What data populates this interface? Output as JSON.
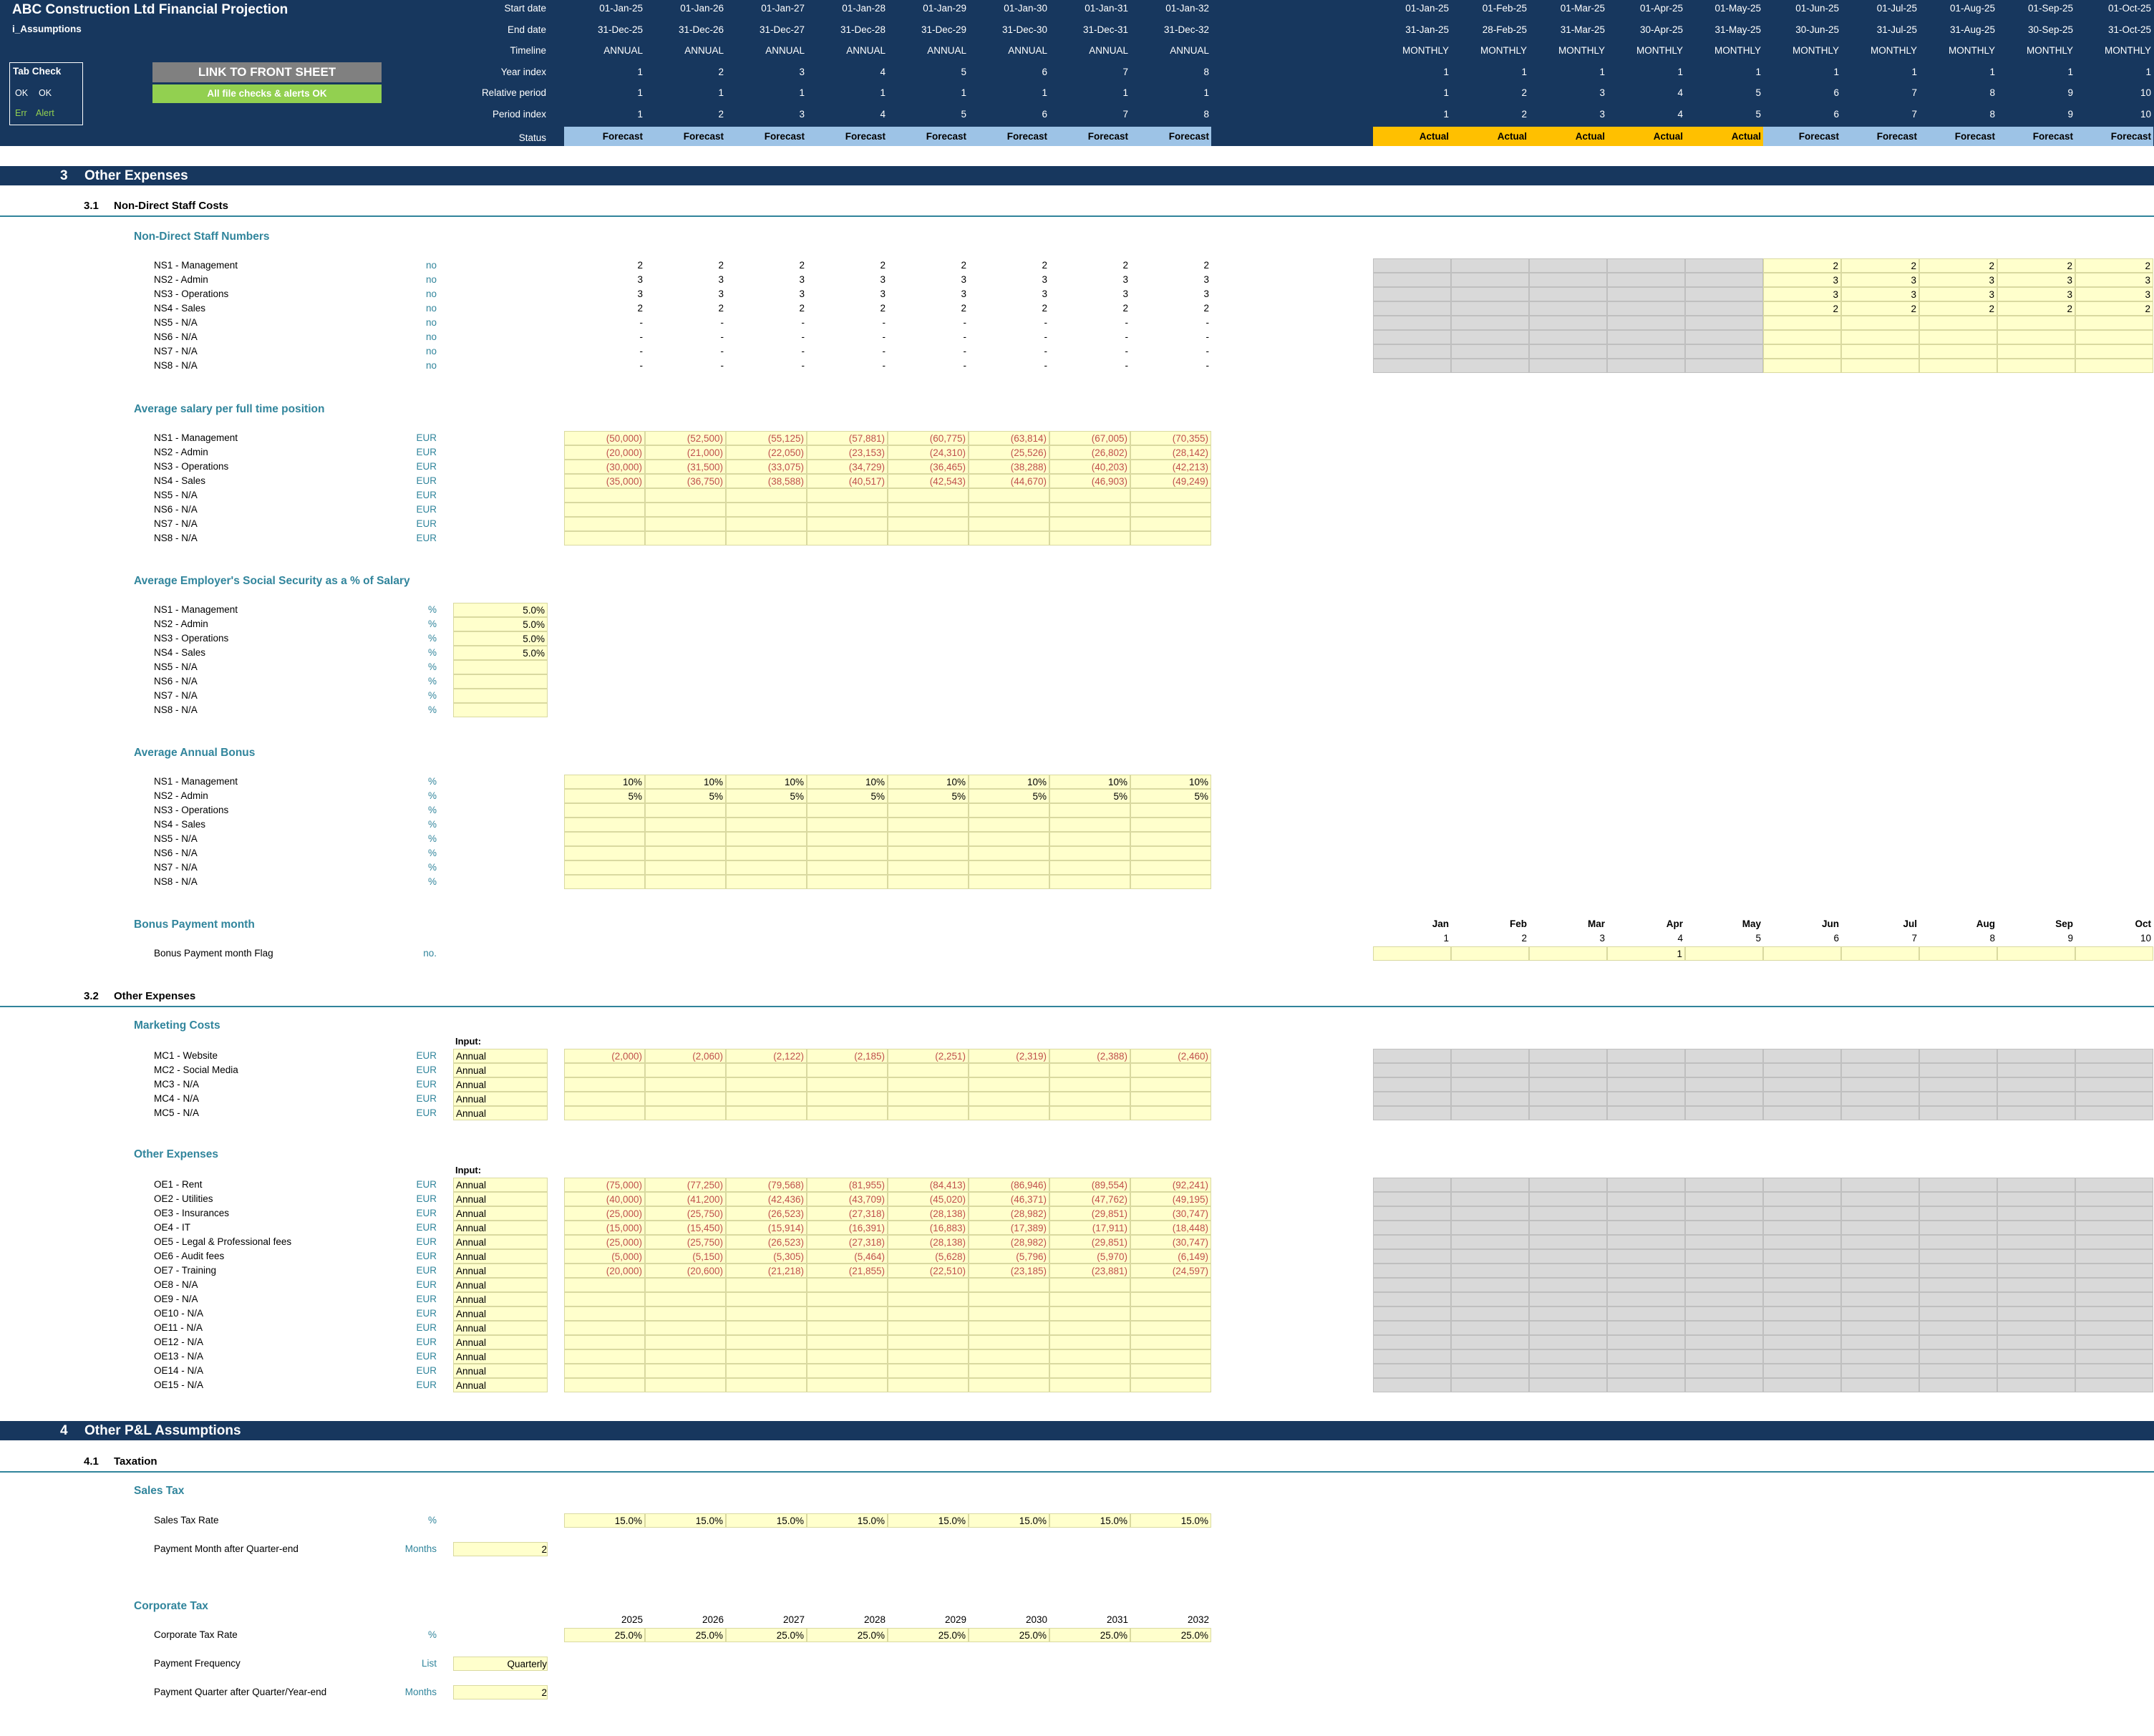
{
  "app": {
    "title": "ABC Construction Ltd Financial Projection",
    "sheet": "i_Assumptions"
  },
  "tab_check": {
    "title": "Tab Check",
    "ok_code": "OK",
    "ok_label": "OK",
    "err_code": "Err",
    "err_label": "Alert"
  },
  "link_button": "LINK TO FRONT SHEET",
  "checks_status": "All file checks & alerts OK",
  "header_rows": [
    "Start date",
    "End date",
    "Timeline",
    "Year index",
    "Relative period",
    "Period index",
    "Status"
  ],
  "annual_cols": [
    {
      "start": "01-Jan-25",
      "end": "31-Dec-25",
      "timeline": "ANNUAL",
      "year_index": "1",
      "rel": "1",
      "period": "1",
      "status": "Forecast"
    },
    {
      "start": "01-Jan-26",
      "end": "31-Dec-26",
      "timeline": "ANNUAL",
      "year_index": "2",
      "rel": "1",
      "period": "2",
      "status": "Forecast"
    },
    {
      "start": "01-Jan-27",
      "end": "31-Dec-27",
      "timeline": "ANNUAL",
      "year_index": "3",
      "rel": "1",
      "period": "3",
      "status": "Forecast"
    },
    {
      "start": "01-Jan-28",
      "end": "31-Dec-28",
      "timeline": "ANNUAL",
      "year_index": "4",
      "rel": "1",
      "period": "4",
      "status": "Forecast"
    },
    {
      "start": "01-Jan-29",
      "end": "31-Dec-29",
      "timeline": "ANNUAL",
      "year_index": "5",
      "rel": "1",
      "period": "5",
      "status": "Forecast"
    },
    {
      "start": "01-Jan-30",
      "end": "31-Dec-30",
      "timeline": "ANNUAL",
      "year_index": "6",
      "rel": "1",
      "period": "6",
      "status": "Forecast"
    },
    {
      "start": "01-Jan-31",
      "end": "31-Dec-31",
      "timeline": "ANNUAL",
      "year_index": "7",
      "rel": "1",
      "period": "7",
      "status": "Forecast"
    },
    {
      "start": "01-Jan-32",
      "end": "31-Dec-32",
      "timeline": "ANNUAL",
      "year_index": "8",
      "rel": "1",
      "period": "8",
      "status": "Forecast"
    }
  ],
  "monthly_cols": [
    {
      "start": "01-Jan-25",
      "end": "31-Jan-25",
      "timeline": "MONTHLY",
      "year_index": "1",
      "rel": "1",
      "period": "1",
      "status": "Actual",
      "month": "Jan",
      "mnum": "1",
      "flag": ""
    },
    {
      "start": "01-Feb-25",
      "end": "28-Feb-25",
      "timeline": "MONTHLY",
      "year_index": "1",
      "rel": "2",
      "period": "2",
      "status": "Actual",
      "month": "Feb",
      "mnum": "2",
      "flag": ""
    },
    {
      "start": "01-Mar-25",
      "end": "31-Mar-25",
      "timeline": "MONTHLY",
      "year_index": "1",
      "rel": "3",
      "period": "3",
      "status": "Actual",
      "month": "Mar",
      "mnum": "3",
      "flag": ""
    },
    {
      "start": "01-Apr-25",
      "end": "30-Apr-25",
      "timeline": "MONTHLY",
      "year_index": "1",
      "rel": "4",
      "period": "4",
      "status": "Actual",
      "month": "Apr",
      "mnum": "4",
      "flag": "1"
    },
    {
      "start": "01-May-25",
      "end": "31-May-25",
      "timeline": "MONTHLY",
      "year_index": "1",
      "rel": "5",
      "period": "5",
      "status": "Actual",
      "month": "May",
      "mnum": "5",
      "flag": ""
    },
    {
      "start": "01-Jun-25",
      "end": "30-Jun-25",
      "timeline": "MONTHLY",
      "year_index": "1",
      "rel": "6",
      "period": "6",
      "status": "Forecast",
      "month": "Jun",
      "mnum": "6",
      "flag": ""
    },
    {
      "start": "01-Jul-25",
      "end": "31-Jul-25",
      "timeline": "MONTHLY",
      "year_index": "1",
      "rel": "7",
      "period": "7",
      "status": "Forecast",
      "month": "Jul",
      "mnum": "7",
      "flag": ""
    },
    {
      "start": "01-Aug-25",
      "end": "31-Aug-25",
      "timeline": "MONTHLY",
      "year_index": "1",
      "rel": "8",
      "period": "8",
      "status": "Forecast",
      "month": "Aug",
      "mnum": "8",
      "flag": ""
    },
    {
      "start": "01-Sep-25",
      "end": "30-Sep-25",
      "timeline": "MONTHLY",
      "year_index": "1",
      "rel": "9",
      "period": "9",
      "status": "Forecast",
      "month": "Sep",
      "mnum": "9",
      "flag": ""
    },
    {
      "start": "01-Oct-25",
      "end": "31-Oct-25",
      "timeline": "MONTHLY",
      "year_index": "1",
      "rel": "10",
      "period": "10",
      "status": "Forecast",
      "month": "Oct",
      "mnum": "10",
      "flag": ""
    }
  ],
  "section3": {
    "num": "3",
    "title": "Other Expenses"
  },
  "sub31": {
    "num": "3.1",
    "title": "Non-Direct Staff Costs"
  },
  "staff_numbers": {
    "title": "Non-Direct Staff Numbers",
    "rows": [
      {
        "label": "NS1 - Management",
        "unit": "no",
        "values": [
          "2",
          "2",
          "2",
          "2",
          "2",
          "2",
          "2",
          "2"
        ],
        "monthly": [
          "2",
          "2",
          "2",
          "2",
          "2"
        ]
      },
      {
        "label": "NS2 - Admin",
        "unit": "no",
        "values": [
          "3",
          "3",
          "3",
          "3",
          "3",
          "3",
          "3",
          "3"
        ],
        "monthly": [
          "3",
          "3",
          "3",
          "3",
          "3"
        ]
      },
      {
        "label": "NS3 - Operations",
        "unit": "no",
        "values": [
          "3",
          "3",
          "3",
          "3",
          "3",
          "3",
          "3",
          "3"
        ],
        "monthly": [
          "3",
          "3",
          "3",
          "3",
          "3"
        ]
      },
      {
        "label": "NS4 - Sales",
        "unit": "no",
        "values": [
          "2",
          "2",
          "2",
          "2",
          "2",
          "2",
          "2",
          "2"
        ],
        "monthly": [
          "2",
          "2",
          "2",
          "2",
          "2"
        ]
      },
      {
        "label": "NS5 - N/A",
        "unit": "no",
        "values": [
          "-",
          "-",
          "-",
          "-",
          "-",
          "-",
          "-",
          "-"
        ],
        "monthly": [
          "",
          "",
          "",
          "",
          ""
        ]
      },
      {
        "label": "NS6 - N/A",
        "unit": "no",
        "values": [
          "-",
          "-",
          "-",
          "-",
          "-",
          "-",
          "-",
          "-"
        ],
        "monthly": [
          "",
          "",
          "",
          "",
          ""
        ]
      },
      {
        "label": "NS7 - N/A",
        "unit": "no",
        "values": [
          "-",
          "-",
          "-",
          "-",
          "-",
          "-",
          "-",
          "-"
        ],
        "monthly": [
          "",
          "",
          "",
          "",
          ""
        ]
      },
      {
        "label": "NS8 - N/A",
        "unit": "no",
        "values": [
          "-",
          "-",
          "-",
          "-",
          "-",
          "-",
          "-",
          "-"
        ],
        "monthly": [
          "",
          "",
          "",
          "",
          ""
        ]
      }
    ]
  },
  "avg_salary": {
    "title": "Average salary per full time position",
    "rows": [
      {
        "label": "NS1 - Management",
        "unit": "EUR",
        "values": [
          "(50,000)",
          "(52,500)",
          "(55,125)",
          "(57,881)",
          "(60,775)",
          "(63,814)",
          "(67,005)",
          "(70,355)"
        ]
      },
      {
        "label": "NS2 - Admin",
        "unit": "EUR",
        "values": [
          "(20,000)",
          "(21,000)",
          "(22,050)",
          "(23,153)",
          "(24,310)",
          "(25,526)",
          "(26,802)",
          "(28,142)"
        ]
      },
      {
        "label": "NS3 - Operations",
        "unit": "EUR",
        "values": [
          "(30,000)",
          "(31,500)",
          "(33,075)",
          "(34,729)",
          "(36,465)",
          "(38,288)",
          "(40,203)",
          "(42,213)"
        ]
      },
      {
        "label": "NS4 - Sales",
        "unit": "EUR",
        "values": [
          "(35,000)",
          "(36,750)",
          "(38,588)",
          "(40,517)",
          "(42,543)",
          "(44,670)",
          "(46,903)",
          "(49,249)"
        ]
      },
      {
        "label": "NS5 - N/A",
        "unit": "EUR",
        "values": [
          "",
          "",
          "",
          "",
          "",
          "",
          "",
          ""
        ]
      },
      {
        "label": "NS6 - N/A",
        "unit": "EUR",
        "values": [
          "",
          "",
          "",
          "",
          "",
          "",
          "",
          ""
        ]
      },
      {
        "label": "NS7 - N/A",
        "unit": "EUR",
        "values": [
          "",
          "",
          "",
          "",
          "",
          "",
          "",
          ""
        ]
      },
      {
        "label": "NS8 - N/A",
        "unit": "EUR",
        "values": [
          "",
          "",
          "",
          "",
          "",
          "",
          "",
          ""
        ]
      }
    ]
  },
  "social_security": {
    "title": "Average Employer's Social Security as a % of Salary",
    "rows": [
      {
        "label": "NS1 - Management",
        "unit": "%",
        "value": "5.0%"
      },
      {
        "label": "NS2 - Admin",
        "unit": "%",
        "value": "5.0%"
      },
      {
        "label": "NS3 - Operations",
        "unit": "%",
        "value": "5.0%"
      },
      {
        "label": "NS4 - Sales",
        "unit": "%",
        "value": "5.0%"
      },
      {
        "label": "NS5 - N/A",
        "unit": "%",
        "value": ""
      },
      {
        "label": "NS6 - N/A",
        "unit": "%",
        "value": ""
      },
      {
        "label": "NS7 - N/A",
        "unit": "%",
        "value": ""
      },
      {
        "label": "NS8 - N/A",
        "unit": "%",
        "value": ""
      }
    ]
  },
  "annual_bonus": {
    "title": "Average Annual Bonus",
    "rows": [
      {
        "label": "NS1 - Management",
        "unit": "%",
        "values": [
          "10%",
          "10%",
          "10%",
          "10%",
          "10%",
          "10%",
          "10%",
          "10%"
        ]
      },
      {
        "label": "NS2 - Admin",
        "unit": "%",
        "values": [
          "5%",
          "5%",
          "5%",
          "5%",
          "5%",
          "5%",
          "5%",
          "5%"
        ]
      },
      {
        "label": "NS3 - Operations",
        "unit": "%",
        "values": [
          "",
          "",
          "",
          "",
          "",
          "",
          "",
          ""
        ]
      },
      {
        "label": "NS4 - Sales",
        "unit": "%",
        "values": [
          "",
          "",
          "",
          "",
          "",
          "",
          "",
          ""
        ]
      },
      {
        "label": "NS5 - N/A",
        "unit": "%",
        "values": [
          "",
          "",
          "",
          "",
          "",
          "",
          "",
          ""
        ]
      },
      {
        "label": "NS6 - N/A",
        "unit": "%",
        "values": [
          "",
          "",
          "",
          "",
          "",
          "",
          "",
          ""
        ]
      },
      {
        "label": "NS7 - N/A",
        "unit": "%",
        "values": [
          "",
          "",
          "",
          "",
          "",
          "",
          "",
          ""
        ]
      },
      {
        "label": "NS8 - N/A",
        "unit": "%",
        "values": [
          "",
          "",
          "",
          "",
          "",
          "",
          "",
          ""
        ]
      }
    ]
  },
  "bonus_month": {
    "title": "Bonus Payment month",
    "flag_label": "Bonus Payment month Flag",
    "flag_unit": "no."
  },
  "sub32": {
    "num": "3.2",
    "title": "Other Expenses"
  },
  "marketing": {
    "title": "Marketing Costs",
    "input_label": "Input:",
    "rows": [
      {
        "label": "MC1 - Website",
        "unit": "EUR",
        "freq": "Annual",
        "values": [
          "(2,000)",
          "(2,060)",
          "(2,122)",
          "(2,185)",
          "(2,251)",
          "(2,319)",
          "(2,388)",
          "(2,460)"
        ]
      },
      {
        "label": "MC2 - Social Media",
        "unit": "EUR",
        "freq": "Annual",
        "values": [
          "",
          "",
          "",
          "",
          "",
          "",
          "",
          ""
        ]
      },
      {
        "label": "MC3 - N/A",
        "unit": "EUR",
        "freq": "Annual",
        "values": [
          "",
          "",
          "",
          "",
          "",
          "",
          "",
          ""
        ]
      },
      {
        "label": "MC4 - N/A",
        "unit": "EUR",
        "freq": "Annual",
        "values": [
          "",
          "",
          "",
          "",
          "",
          "",
          "",
          ""
        ]
      },
      {
        "label": "MC5 - N/A",
        "unit": "EUR",
        "freq": "Annual",
        "values": [
          "",
          "",
          "",
          "",
          "",
          "",
          "",
          ""
        ]
      }
    ]
  },
  "other_expenses": {
    "title": "Other Expenses",
    "input_label": "Input:",
    "rows": [
      {
        "label": "OE1 - Rent",
        "unit": "EUR",
        "freq": "Annual",
        "values": [
          "(75,000)",
          "(77,250)",
          "(79,568)",
          "(81,955)",
          "(84,413)",
          "(86,946)",
          "(89,554)",
          "(92,241)"
        ]
      },
      {
        "label": "OE2 - Utilities",
        "unit": "EUR",
        "freq": "Annual",
        "values": [
          "(40,000)",
          "(41,200)",
          "(42,436)",
          "(43,709)",
          "(45,020)",
          "(46,371)",
          "(47,762)",
          "(49,195)"
        ]
      },
      {
        "label": "OE3 - Insurances",
        "unit": "EUR",
        "freq": "Annual",
        "values": [
          "(25,000)",
          "(25,750)",
          "(26,523)",
          "(27,318)",
          "(28,138)",
          "(28,982)",
          "(29,851)",
          "(30,747)"
        ]
      },
      {
        "label": "OE4 - IT",
        "unit": "EUR",
        "freq": "Annual",
        "values": [
          "(15,000)",
          "(15,450)",
          "(15,914)",
          "(16,391)",
          "(16,883)",
          "(17,389)",
          "(17,911)",
          "(18,448)"
        ]
      },
      {
        "label": "OE5 - Legal & Professional fees",
        "unit": "EUR",
        "freq": "Annual",
        "values": [
          "(25,000)",
          "(25,750)",
          "(26,523)",
          "(27,318)",
          "(28,138)",
          "(28,982)",
          "(29,851)",
          "(30,747)"
        ]
      },
      {
        "label": "OE6 - Audit fees",
        "unit": "EUR",
        "freq": "Annual",
        "values": [
          "(5,000)",
          "(5,150)",
          "(5,305)",
          "(5,464)",
          "(5,628)",
          "(5,796)",
          "(5,970)",
          "(6,149)"
        ]
      },
      {
        "label": "OE7 - Training",
        "unit": "EUR",
        "freq": "Annual",
        "values": [
          "(20,000)",
          "(20,600)",
          "(21,218)",
          "(21,855)",
          "(22,510)",
          "(23,185)",
          "(23,881)",
          "(24,597)"
        ]
      },
      {
        "label": "OE8 - N/A",
        "unit": "EUR",
        "freq": "Annual",
        "values": [
          "",
          "",
          "",
          "",
          "",
          "",
          "",
          ""
        ]
      },
      {
        "label": "OE9 - N/A",
        "unit": "EUR",
        "freq": "Annual",
        "values": [
          "",
          "",
          "",
          "",
          "",
          "",
          "",
          ""
        ]
      },
      {
        "label": "OE10 - N/A",
        "unit": "EUR",
        "freq": "Annual",
        "values": [
          "",
          "",
          "",
          "",
          "",
          "",
          "",
          ""
        ]
      },
      {
        "label": "OE11 - N/A",
        "unit": "EUR",
        "freq": "Annual",
        "values": [
          "",
          "",
          "",
          "",
          "",
          "",
          "",
          ""
        ]
      },
      {
        "label": "OE12 - N/A",
        "unit": "EUR",
        "freq": "Annual",
        "values": [
          "",
          "",
          "",
          "",
          "",
          "",
          "",
          ""
        ]
      },
      {
        "label": "OE13 - N/A",
        "unit": "EUR",
        "freq": "Annual",
        "values": [
          "",
          "",
          "",
          "",
          "",
          "",
          "",
          ""
        ]
      },
      {
        "label": "OE14 - N/A",
        "unit": "EUR",
        "freq": "Annual",
        "values": [
          "",
          "",
          "",
          "",
          "",
          "",
          "",
          ""
        ]
      },
      {
        "label": "OE15 - N/A",
        "unit": "EUR",
        "freq": "Annual",
        "values": [
          "",
          "",
          "",
          "",
          "",
          "",
          "",
          ""
        ]
      }
    ]
  },
  "section4": {
    "num": "4",
    "title": "Other P&L Assumptions"
  },
  "sub41": {
    "num": "4.1",
    "title": "Taxation"
  },
  "sales_tax": {
    "title": "Sales Tax",
    "rate_label": "Sales Tax Rate",
    "rate_unit": "%",
    "rates": [
      "15.0%",
      "15.0%",
      "15.0%",
      "15.0%",
      "15.0%",
      "15.0%",
      "15.0%",
      "15.0%"
    ],
    "pay_label": "Payment Month after Quarter-end",
    "pay_unit": "Months",
    "pay_value": "2"
  },
  "corp_tax": {
    "title": "Corporate Tax",
    "years": [
      "2025",
      "2026",
      "2027",
      "2028",
      "2029",
      "2030",
      "2031",
      "2032"
    ],
    "rate_label": "Corporate Tax Rate",
    "rate_unit": "%",
    "rates": [
      "25.0%",
      "25.0%",
      "25.0%",
      "25.0%",
      "25.0%",
      "25.0%",
      "25.0%",
      "25.0%"
    ],
    "freq_label": "Payment Frequency",
    "freq_unit": "List",
    "freq_value": "Quarterly",
    "pay_label": "Payment Quarter after Quarter/Year-end",
    "pay_unit": "Months",
    "pay_value": "2"
  },
  "colors": {
    "header_bg": "#17375e",
    "forecast": "#9dc3e6",
    "actual": "#ffc000",
    "input_yellow": "#ffffcc",
    "negative_red": "#c0504d",
    "unit_teal": "#31859c",
    "button_grey": "#808080",
    "ok_green": "#92d050"
  }
}
